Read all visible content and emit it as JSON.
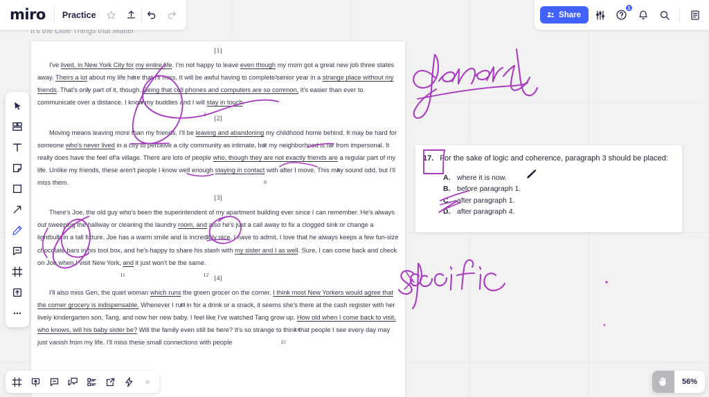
{
  "app": {
    "brand": "miro",
    "board_name": "Practice",
    "board_subtitle": "It's the Little Things that Matter",
    "accent_color": "#4262ff",
    "ink_color": "#a83bc0",
    "canvas_bg": "#f2f2f2"
  },
  "header": {
    "left_actions": [
      {
        "name": "star-icon",
        "label": "Favorite"
      },
      {
        "name": "upload-icon",
        "label": "Upload"
      },
      {
        "name": "undo-icon",
        "label": "Undo"
      },
      {
        "name": "redo-icon",
        "label": "Redo"
      }
    ],
    "share_label": "Share",
    "right_actions": [
      {
        "name": "sliders-icon",
        "label": "Board settings"
      },
      {
        "name": "help-icon",
        "label": "Help",
        "badge": "1"
      },
      {
        "name": "bell-icon",
        "label": "Notifications"
      },
      {
        "name": "search-icon",
        "label": "Search"
      },
      {
        "name": "notes-panel-icon",
        "label": "Notes"
      }
    ]
  },
  "left_toolbar": {
    "items": [
      {
        "name": "cursor-tool",
        "label": "Select",
        "active": false
      },
      {
        "name": "templates-tool",
        "label": "Templates",
        "active": false
      },
      {
        "name": "text-tool",
        "label": "Text",
        "active": false
      },
      {
        "name": "sticky-note-tool",
        "label": "Sticky note",
        "active": false
      },
      {
        "name": "shapes-tool",
        "label": "Shapes",
        "active": false
      },
      {
        "name": "connection-line-tool",
        "label": "Connection line",
        "active": false
      },
      {
        "name": "pen-tool",
        "label": "Pen",
        "active": true
      },
      {
        "name": "comment-tool",
        "label": "Comment",
        "active": false
      },
      {
        "name": "frame-tool",
        "label": "Frame",
        "active": false
      },
      {
        "name": "upload-tool",
        "label": "Upload",
        "active": false
      },
      {
        "name": "more-tools",
        "label": "More tools",
        "active": false
      }
    ]
  },
  "bottom_toolbar": {
    "items": [
      {
        "name": "frames-panel-icon",
        "label": "Frames"
      },
      {
        "name": "presentation-icon",
        "label": "Presentation mode"
      },
      {
        "name": "comments-icon",
        "label": "Comments"
      },
      {
        "name": "chat-icon",
        "label": "Chat"
      },
      {
        "name": "cards-icon",
        "label": "Cards"
      },
      {
        "name": "export-icon",
        "label": "Export"
      },
      {
        "name": "apps-icon",
        "label": "Apps"
      },
      {
        "name": "collapse-icon",
        "label": "«"
      }
    ]
  },
  "zoom_control": {
    "hand_tool_name": "hand-tool",
    "level": "56%"
  },
  "document": {
    "paragraphs": [
      {
        "number": "[1]",
        "runs": [
          {
            "t": "I've ",
            "u": false
          },
          {
            "t": "lived, in New York City for",
            "u": true
          },
          {
            "t": " ",
            "u": false,
            "q": "1"
          },
          {
            "t": "my entire life",
            "u": true
          },
          {
            "t": ". I'm not happy to leave ",
            "u": false
          },
          {
            "t": "even though",
            "u": true
          },
          {
            "t": " ",
            "u": false,
            "q": "2"
          },
          {
            "t": "my mom got a great new job three states away. ",
            "u": false
          },
          {
            "t": "Theirs a lot",
            "u": true
          },
          {
            "t": " ",
            "u": false,
            "q": "3"
          },
          {
            "t": "about my life here that I'll miss. It will be awful having to complete senior year in a ",
            "u": false
          },
          {
            "t": "strange place without my friends",
            "u": true
          },
          {
            "t": ". That's only part of it, though. ",
            "u": false,
            "q": "4"
          },
          {
            "t": "Being that cell phones and computers are so common,",
            "u": true
          },
          {
            "t": " it's easier than ever to communicate over a distance. I know my buddies and I will ",
            "u": false,
            "q": "5"
          },
          {
            "t": "stay in touch",
            "u": true
          },
          {
            "t": ".",
            "u": false
          }
        ]
      },
      {
        "number": "[2]",
        "runs": [
          {
            "t": "Moving means leaving more than my friends. I'll be ",
            "u": false
          },
          {
            "t": "leaving and abandoning",
            "u": true
          },
          {
            "t": " ",
            "u": false,
            "q": "6"
          },
          {
            "t": "my childhood home behind. It may be hard for someone ",
            "u": false
          },
          {
            "t": "who's never lived",
            "u": true
          },
          {
            "t": " ",
            "u": false,
            "q": "7"
          },
          {
            "t": "in a city to perceive a city community as intimate, but my neighborhood is far from impersonal. It really does have the feel of a village. There are lots of people ",
            "u": false
          },
          {
            "t": "who, though they are not exactly friends are",
            "u": true
          },
          {
            "t": " ",
            "u": false,
            "q": "8"
          },
          {
            "t": "a regular part of my life. Unlike my friends, these aren't people I know well enough ",
            "u": false
          },
          {
            "t": "staying in contact",
            "u": true
          },
          {
            "t": " ",
            "u": false,
            "q": "9"
          },
          {
            "t": "with after I move. This may sound odd, but I'll miss them.",
            "u": false
          }
        ]
      },
      {
        "number": "[3]",
        "runs": [
          {
            "t": "There's Joe, the old guy who's been the superintendent of my apartment building ever since I can remember. He's always out sweeping the hallway or cleaning the laundry ",
            "u": false
          },
          {
            "t": "room, and",
            "u": true
          },
          {
            "t": " ",
            "u": false,
            "q": "10"
          },
          {
            "t": "also he's just a call away to fix a clogged sink or change a lightbulb in a tall fixture. Joe has a warm smile and is incredibly nice. I have to admit, I love that he always keeps a few fun-size chocolate bars in his tool box, and he's happy to share his stash with ",
            "u": false
          },
          {
            "t": "my sister and I as well",
            "u": true
          },
          {
            "t": ". Sure, I can come back and check on Joe when I visit New York, ",
            "u": false,
            "q": "11"
          },
          {
            "t": "and",
            "u": true
          },
          {
            "t": " it just won't be the same.",
            "u": false,
            "q": "12"
          }
        ]
      },
      {
        "number": "[4]",
        "runs": [
          {
            "t": "I'll also miss Gen, the quiet woman ",
            "u": false
          },
          {
            "t": "which runs",
            "u": true
          },
          {
            "t": " ",
            "u": false,
            "q": "13"
          },
          {
            "t": "the green grocer on the corner. ",
            "u": false
          },
          {
            "t": "I think most New Yorkers would agree that the corner grocery is indispensable.",
            "u": true
          },
          {
            "t": " Whenever I run in for a drink or a snack, it seems she's there at the cash register with her lively kindergarten son, Tang, and now her new baby. I feel like I've watched Tang grow up. ",
            "u": false,
            "q": "14"
          },
          {
            "t": "How old when I come back to visit, who knows, will his baby sister be?",
            "u": true
          },
          {
            "t": " Will the family even still be here? It's so strange to ",
            "u": false,
            "q": "15"
          },
          {
            "t": "think that people I see every day may just vanish from my life. I'll miss these small connections with people",
            "u": false
          }
        ]
      }
    ]
  },
  "question_card": {
    "number": "17.",
    "stem": "For the sake of logic and coherence, paragraph 3 should be placed:",
    "choices": [
      {
        "label": "A.",
        "text": "where it is now."
      },
      {
        "label": "B.",
        "text": "before paragraph 1."
      },
      {
        "label": "C.",
        "text": "after paragraph 1."
      },
      {
        "label": "D.",
        "text": "after paragraph 4."
      }
    ]
  },
  "annotations": [
    {
      "name": "handwriting-general",
      "text": "general"
    },
    {
      "name": "handwriting-specific",
      "text": "specific"
    }
  ]
}
